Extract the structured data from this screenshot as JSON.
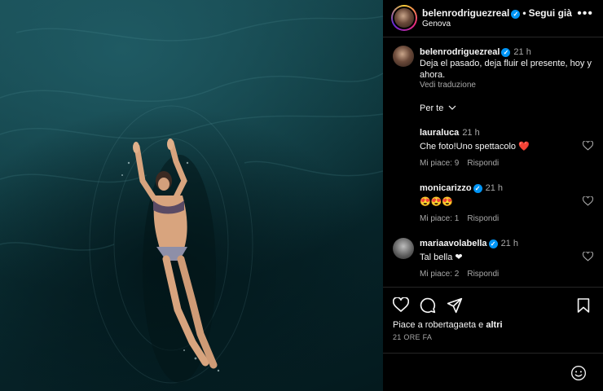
{
  "post": {
    "username": "belenrodriguezreal",
    "follow_label": "Segui già",
    "location": "Genova",
    "caption_time": "21 h",
    "caption_text": "Deja el pasado, deja fluir el presente, hoy y ahora.",
    "translate_label": "Vedi traduzione",
    "sort_label": "Per te"
  },
  "comments": [
    {
      "username": "lauraluca",
      "time": "21 h",
      "text": "Che foto!Uno spettacolo ❤️",
      "likes": "Mi piace: 9",
      "reply": "Rispondi"
    },
    {
      "username": "monicarizzo",
      "time": "21 h",
      "text": "😍😍😍",
      "likes": "Mi piace: 1",
      "reply": "Rispondi"
    },
    {
      "username": "mariaavolabella",
      "time": "21 h",
      "text": "Tal bella ❤",
      "likes": "Mi piace: 2",
      "reply": "Rispondi"
    }
  ],
  "footer": {
    "likes_prefix": "Piace a robertagaeta e ",
    "likes_suffix": "altri",
    "ago": "21 ORE FA"
  },
  "icons": {
    "more": "more-horizontal-icon",
    "heart": "heart-icon",
    "comment": "comment-icon",
    "share": "send-icon",
    "save": "bookmark-icon",
    "emoji": "emoji-icon",
    "verified": "verified-badge-icon"
  },
  "colors": {
    "background": "#000000",
    "text": "#f5f5f5",
    "muted": "#a8a8a8",
    "verified": "#0095f6",
    "heart_red": "#ff3040",
    "water": "#0c3338"
  }
}
